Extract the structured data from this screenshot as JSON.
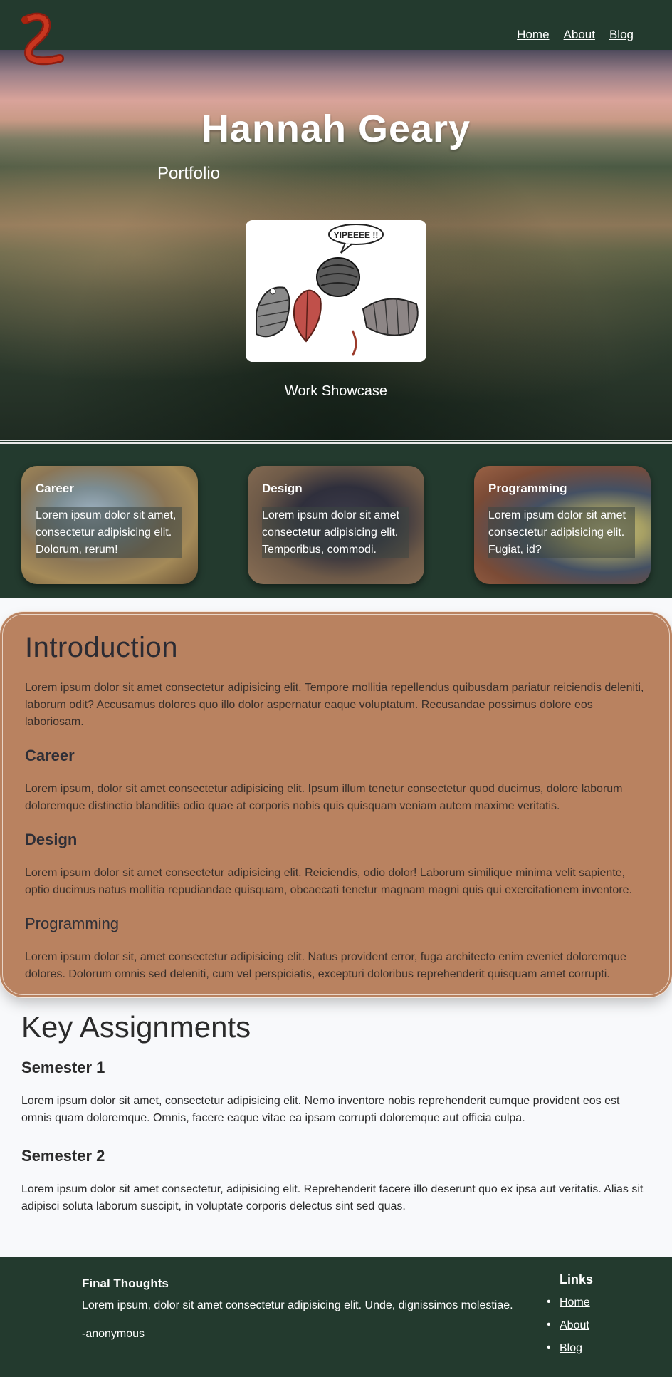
{
  "nav": {
    "links": [
      "Home",
      "About",
      "Blog"
    ]
  },
  "hero": {
    "title": "Hannah Geary",
    "subtitle": "Portfolio",
    "caption": "Work Showcase",
    "cartoon_text": "YIPEEEE !!"
  },
  "categories": [
    {
      "title": "Career",
      "text": "Lorem ipsum dolor sit amet, consectetur adipisicing elit. Dolorum, rerum!"
    },
    {
      "title": "Design",
      "text": "Lorem ipsum dolor sit amet consectetur adipisicing elit. Temporibus, commodi."
    },
    {
      "title": "Programming",
      "text": "Lorem ipsum dolor sit amet consectetur adipisicing elit. Fugiat, id?"
    }
  ],
  "intro": {
    "heading": "Introduction",
    "text": "Lorem ipsum dolor sit amet consectetur adipisicing elit. Tempore mollitia repellendus quibusdam pariatur reiciendis deleniti, laborum odit? Accusamus dolores quo illo dolor aspernatur eaque voluptatum. Recusandae possimus dolore eos laboriosam.",
    "sections": [
      {
        "heading": "Career",
        "text": "Lorem ipsum, dolor sit amet consectetur adipisicing elit. Ipsum illum tenetur consectetur quod ducimus, dolore laborum doloremque distinctio blanditiis odio quae at corporis nobis quis quisquam veniam autem maxime veritatis."
      },
      {
        "heading": "Design",
        "text": "Lorem ipsum dolor sit amet consectetur adipisicing elit. Reiciendis, odio dolor! Laborum similique minima velit sapiente, optio ducimus natus mollitia repudiandae quisquam, obcaecati tenetur magnam magni quis qui exercitationem inventore."
      },
      {
        "heading": "Programming",
        "text": "Lorem ipsum dolor sit, amet consectetur adipisicing elit. Natus provident error, fuga architecto enim eveniet doloremque dolores. Dolorum omnis sed deleniti, cum vel perspiciatis, excepturi doloribus reprehenderit quisquam amet corrupti."
      }
    ]
  },
  "assignments": {
    "heading": "Key Assignments",
    "semesters": [
      {
        "heading": "Semester 1",
        "text": "Lorem ipsum dolor sit amet, consectetur adipisicing elit. Nemo inventore nobis reprehenderit cumque provident eos est omnis quam doloremque. Omnis, facere eaque vitae ea ipsam corrupti doloremque aut officia culpa."
      },
      {
        "heading": "Semester 2",
        "text": "Lorem ipsum dolor sit amet consectetur, adipisicing elit. Reprehenderit facere illo deserunt quo ex ipsa aut veritatis. Alias sit adipisci soluta laborum suscipit, in voluptate corporis delectus sint sed quas."
      }
    ]
  },
  "footer": {
    "title": "Final Thoughts",
    "text": "Lorem ipsum, dolor sit amet consectetur adipisicing elit. Unde, dignissimos molestiae.",
    "signature": "-anonymous",
    "links_title": "Links",
    "links": [
      "Home",
      "About",
      "Blog"
    ]
  },
  "colors": {
    "dark_green": "#233a2e",
    "intro_bg": "#b98260",
    "page_bg": "#f8f9fb"
  }
}
